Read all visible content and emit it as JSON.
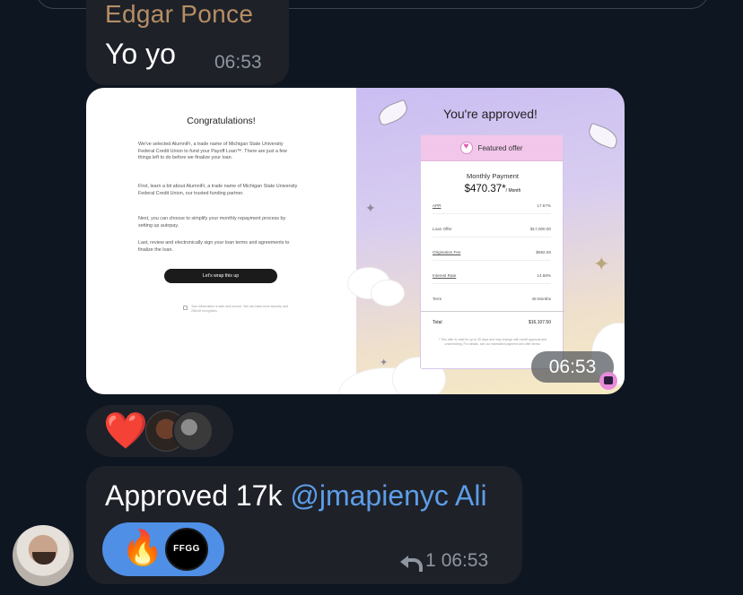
{
  "message1": {
    "sender": "Edgar Ponce",
    "text": "Yo yo",
    "time": "06:53"
  },
  "photo_message": {
    "time": "06:53",
    "left_panel": {
      "heading": "Congratulations!",
      "paragraphs": [
        "We've selected AlumniFi, a trade name of Michigan State University Federal Credit Union to fund your Payoff Loan™. There are just a few things left to do before we finalize your loan.",
        "First, learn a bit about AlumniFi, a trade name of Michigan State University Federal Credit Union, our trusted funding partner.",
        "Next, you can choose to simplify your monthly repayment process by setting up autopay.",
        "Last, review and electronically sign your loan terms and agreements to finalize the loan."
      ],
      "button": "Let's wrap this up",
      "security_note": "Your information is safe and secure. We use bank-level security and 256-bit encryption."
    },
    "right_panel": {
      "heading": "You're approved!",
      "card_header": "Featured offer",
      "monthly_label": "Monthly Payment",
      "monthly_amount": "$470.37*",
      "monthly_unit": "/ Month",
      "rows": [
        {
          "label": "APR",
          "value": "17.67%"
        },
        {
          "label": "Loan Offer",
          "value": "$17,000.00"
        },
        {
          "label": "Origination Fee",
          "value": "$592.50"
        },
        {
          "label": "Interest Rate",
          "value": "14.68%"
        },
        {
          "label": "Term",
          "value": "48 Months"
        }
      ],
      "total_label": "Total",
      "total_value": "$16,107.50",
      "note": "* This offer is valid for up to 30 days and may change with credit approval and underwriting. For details, see our estimated payment and offer terms."
    }
  },
  "reactions1": {
    "emoji": "❤️",
    "icons": [
      "heart-icon",
      "avatar",
      "avatar"
    ]
  },
  "message3": {
    "text": "Approved 17k ",
    "mention": "@jmapienyc Ali",
    "reaction_emoji": "🔥",
    "reaction_avatar_text": "FFGG",
    "reply_count": "1",
    "time": "06:53"
  },
  "colors": {
    "background": "#0e1621",
    "bubble": "#1e2128",
    "mention": "#5d9de8",
    "reaction_selected": "#4f8fe6",
    "sender_name": "#c79a6b"
  }
}
